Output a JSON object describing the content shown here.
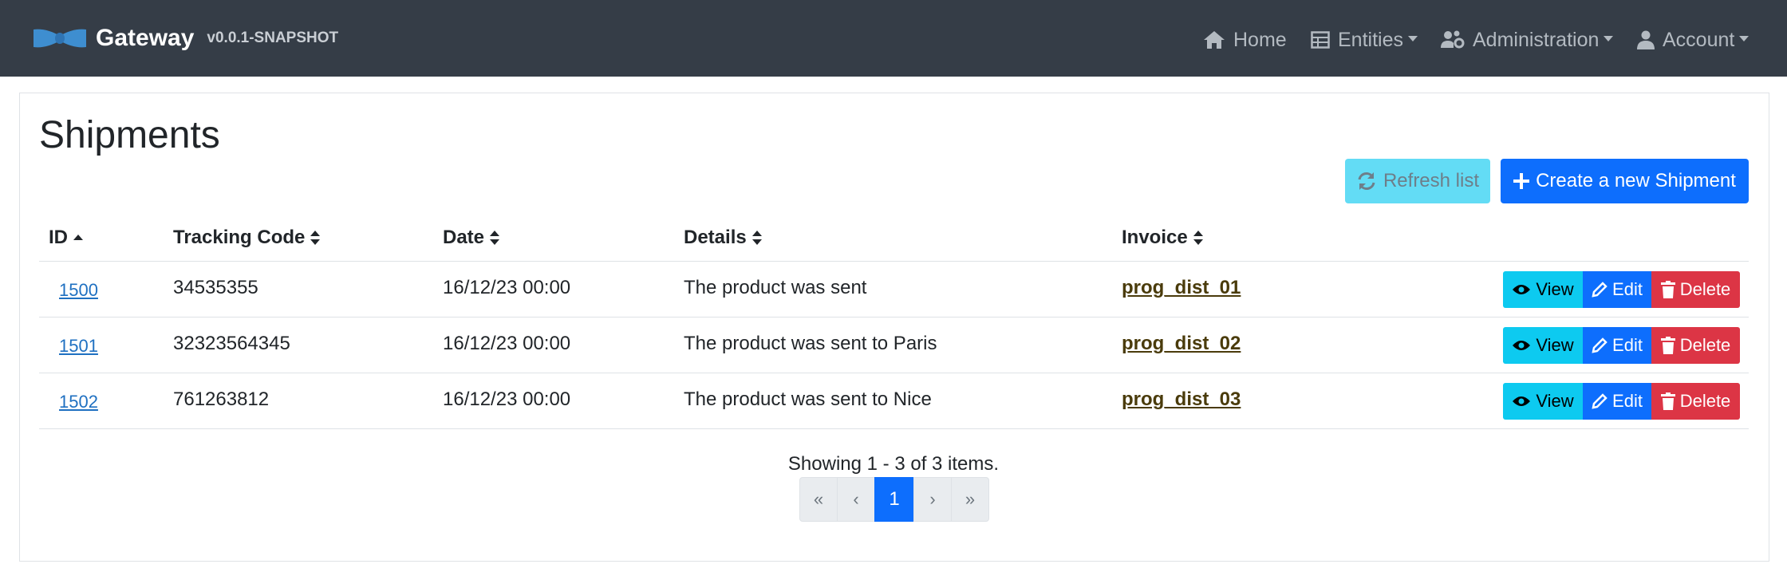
{
  "navbar": {
    "brand_name": "Gateway",
    "version": "v0.0.1-SNAPSHOT",
    "items": [
      {
        "label": "Home",
        "icon": "home-icon"
      },
      {
        "label": "Entities",
        "icon": "table-icon"
      },
      {
        "label": "Administration",
        "icon": "users-cog-icon"
      },
      {
        "label": "Account",
        "icon": "user-icon"
      }
    ]
  },
  "page": {
    "title": "Shipments",
    "refresh_label": "Refresh list",
    "create_label": "Create a new Shipment"
  },
  "table": {
    "columns": [
      "ID",
      "Tracking Code",
      "Date",
      "Details",
      "Invoice"
    ],
    "sort": {
      "column": "ID",
      "direction": "ascending"
    },
    "rows": [
      {
        "id": "1500",
        "tracking": "34535355",
        "date": "16/12/23 00:00",
        "details": "The product was sent",
        "invoice": "prog_dist_01"
      },
      {
        "id": "1501",
        "tracking": "32323564345",
        "date": "16/12/23 00:00",
        "details": "The product was sent to Paris",
        "invoice": "prog_dist_02"
      },
      {
        "id": "1502",
        "tracking": "761263812",
        "date": "16/12/23 00:00",
        "details": "The product was sent to Nice",
        "invoice": "prog_dist_03"
      }
    ],
    "actions": {
      "view": "View",
      "edit": "Edit",
      "delete": "Delete"
    }
  },
  "pagination": {
    "summary": "Showing 1 - 3 of 3 items.",
    "first": "«",
    "prev": "‹",
    "current": "1",
    "next": "›",
    "last": "»"
  },
  "colors": {
    "navbar_bg": "#353d47",
    "primary": "#0d6efd",
    "info": "#0dcaf0",
    "danger": "#dc3545"
  }
}
